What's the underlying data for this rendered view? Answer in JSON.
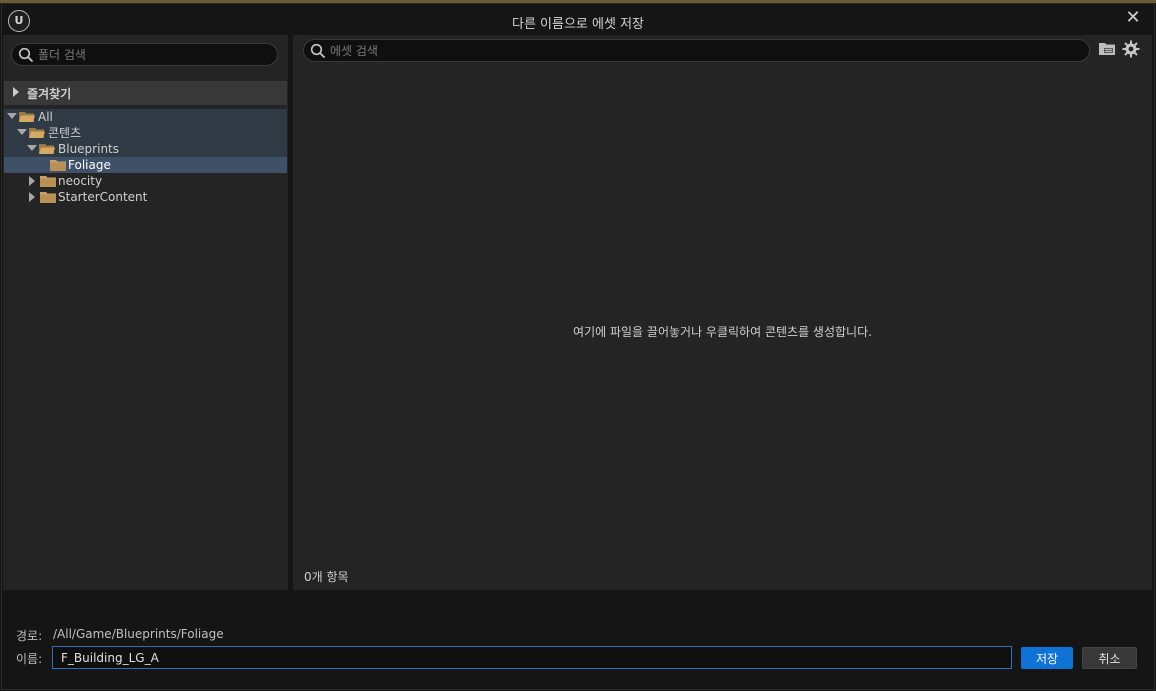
{
  "window": {
    "title": "다른 이름으로 에셋 저장",
    "logo_icon": "unreal-engine-logo",
    "close_icon": "close-icon"
  },
  "left_panel": {
    "folder_search_placeholder": "폴더 검색",
    "favorites_label": "즐겨찾기",
    "tree": [
      {
        "label": "All",
        "level": 0,
        "expanded": true,
        "state": "selected-parent"
      },
      {
        "label": "콘텐츠",
        "level": 1,
        "expanded": true,
        "state": "selected-parent"
      },
      {
        "label": "Blueprints",
        "level": 2,
        "expanded": true,
        "state": "selected-parent"
      },
      {
        "label": "Foliage",
        "level": 3,
        "expanded": null,
        "state": "selected"
      },
      {
        "label": "neocity",
        "level": 2,
        "expanded": false,
        "state": "normal"
      },
      {
        "label": "StarterContent",
        "level": 2,
        "expanded": false,
        "state": "normal"
      }
    ]
  },
  "right_panel": {
    "asset_search_placeholder": "에셋 검색",
    "empty_message": "여기에 파일을 끌어놓거나 우클릭하여 콘텐츠를 생성합니다.",
    "item_count": "0개 항목"
  },
  "bottom": {
    "path_label": "경로:",
    "path_value": "/All/Game/Blueprints/Foliage",
    "name_label": "이름:",
    "name_value": "F_Building_LG_A",
    "save_label": "저장",
    "cancel_label": "취소"
  },
  "colors": {
    "accent": "#0f72d6",
    "selection": "#3e5168",
    "folder": "#c9a063"
  }
}
